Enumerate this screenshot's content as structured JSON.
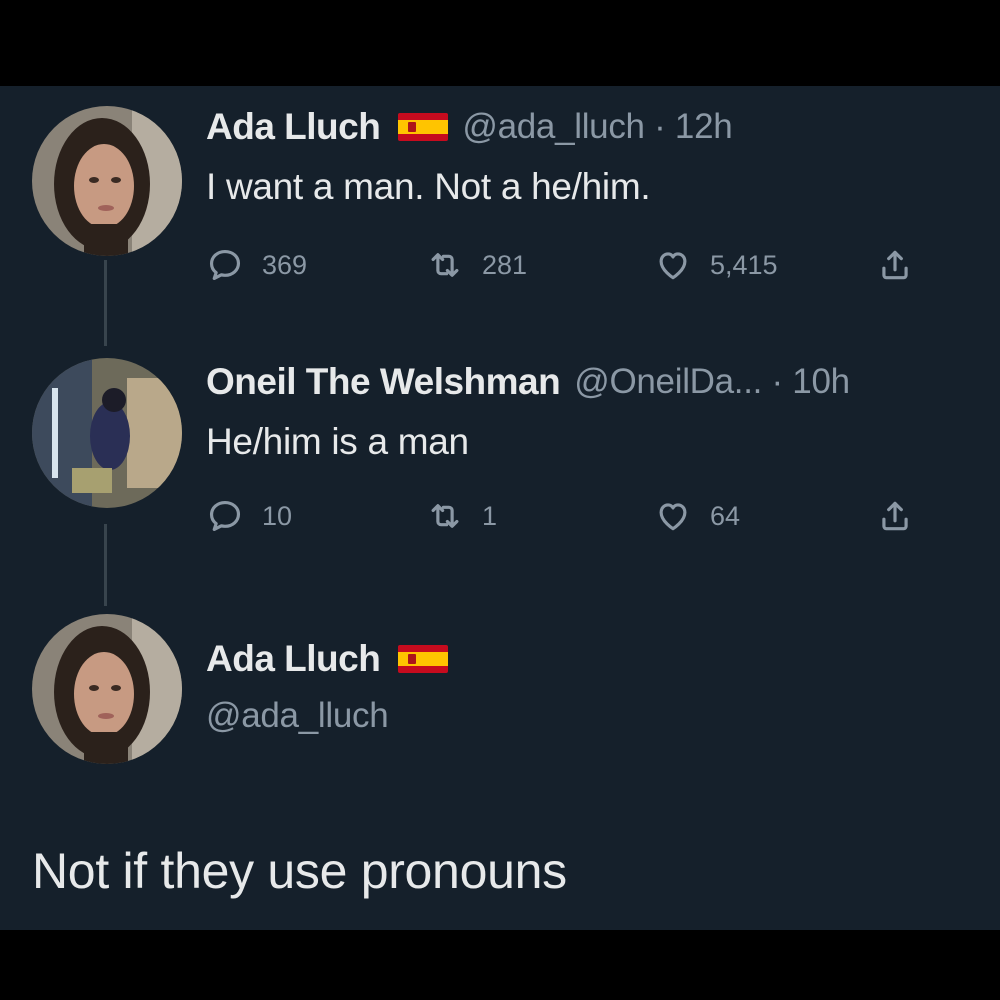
{
  "colors": {
    "background": "#15202b",
    "text_primary": "#e7e9ea",
    "text_secondary": "#8b98a5",
    "thread_line": "#38444d"
  },
  "tweets": [
    {
      "display_name": "Ada Lluch",
      "flag": "spain-flag-icon",
      "handle": "@ada_lluch · 12h",
      "text": "I want a man. Not a he/him.",
      "replies": "369",
      "retweets": "281",
      "likes": "5,415"
    },
    {
      "display_name": "Oneil The Welshman",
      "handle": "@OneilDa... · 10h",
      "text": "He/him is a man",
      "replies": "10",
      "retweets": "1",
      "likes": "64"
    },
    {
      "display_name": "Ada Lluch",
      "flag": "spain-flag-icon",
      "handle": "@ada_lluch",
      "text": "Not if they use pronouns"
    }
  ]
}
